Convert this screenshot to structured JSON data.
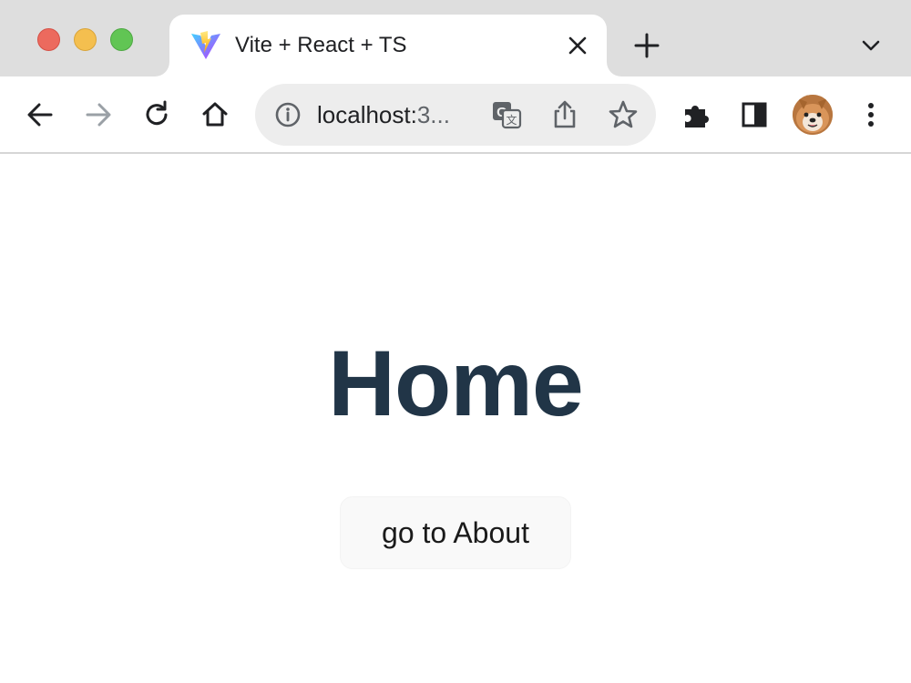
{
  "browser": {
    "tab": {
      "title": "Vite + React + TS",
      "favicon": "vite-logo-icon"
    },
    "omnibox": {
      "url_host": "localhost:",
      "url_rest": "3..."
    },
    "icons": {
      "back": "arrow-left-icon",
      "forward": "arrow-right-icon",
      "reload": "reload-icon",
      "home": "home-icon",
      "site_info": "info-icon",
      "translate": "translate-icon",
      "share": "share-icon",
      "bookmark": "star-icon",
      "extensions": "puzzle-icon",
      "side_panel": "side-panel-icon",
      "menu": "kebab-menu-icon",
      "new_tab": "plus-icon",
      "tab_search": "chevron-down-icon",
      "close_tab": "close-icon"
    },
    "colors": {
      "traffic_red": "#ec6a5e",
      "traffic_yellow": "#f4bf4f",
      "traffic_green": "#61c554"
    }
  },
  "page": {
    "heading": "Home",
    "button_label": "go to About",
    "colors": {
      "heading": "#213547",
      "button_bg": "#f9f9f9"
    }
  }
}
